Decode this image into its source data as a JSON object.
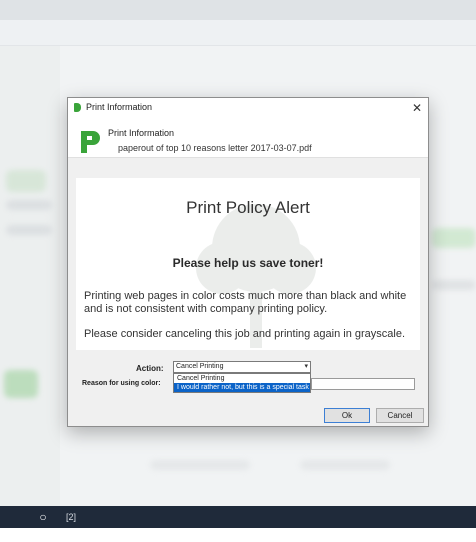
{
  "dialog": {
    "title": "Print Information",
    "header_title": "Print Information",
    "file_name": "paperout of top 10 reasons letter 2017-03-07.pdf"
  },
  "alert": {
    "title": "Print Policy Alert",
    "subtitle": "Please help us save toner!",
    "body1": "Printing web pages in color costs much more than black and white and is not consistent with company printing policy.",
    "body2": "Please consider canceling this job and printing again in grayscale."
  },
  "form": {
    "action_label": "Action:",
    "action_value": "Cancel Printing",
    "action_options": [
      "Cancel Printing",
      "I would rather not, but this is a special task"
    ],
    "reason_label": "Reason for using color:"
  },
  "buttons": {
    "ok": "Ok",
    "cancel": "Cancel"
  },
  "taskbar": {
    "app_label": "[2]"
  },
  "colors": {
    "accent": "#0b63c8",
    "logo_green": "#3aa43a",
    "taskbar": "#1f2a3a"
  }
}
